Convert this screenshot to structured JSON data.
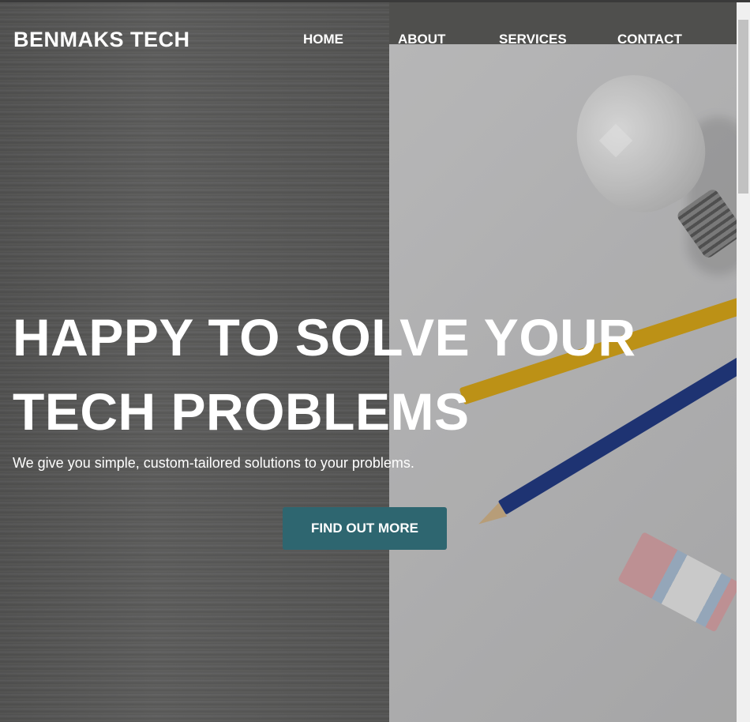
{
  "brand": {
    "name": "BENMAKS TECH"
  },
  "nav": {
    "items": [
      {
        "label": "HOME"
      },
      {
        "label": "ABOUT"
      },
      {
        "label": "SERVICES"
      },
      {
        "label": "CONTACT"
      }
    ]
  },
  "hero": {
    "headline_line1": "HAPPY TO SOLVE YOUR",
    "headline_line2": "TECH PROBLEMS",
    "subtitle": "We give you simple, custom-tailored solutions to your problems.",
    "cta_label": "FIND OUT MORE"
  },
  "colors": {
    "cta": "#2e6670",
    "text": "#ffffff"
  }
}
